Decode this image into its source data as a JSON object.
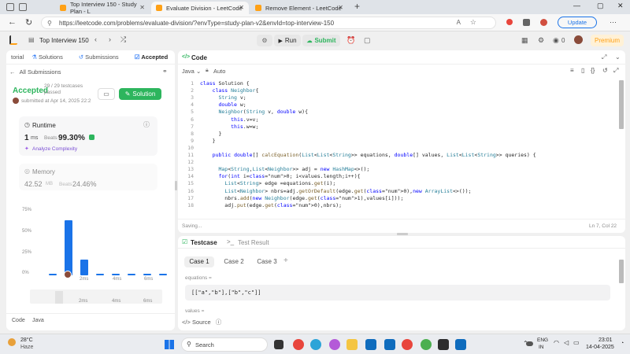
{
  "browser": {
    "tabs": [
      {
        "title": "Top Interview 150 - Study Plan - L",
        "fav": "#ffa116"
      },
      {
        "title": "Evaluate Division - LeetCode",
        "fav": "#ffa116"
      },
      {
        "title": "Remove Element - LeetCode",
        "fav": "#ffa116"
      }
    ],
    "url": "https://leetcode.com/problems/evaluate-division/?envType=study-plan-v2&envId=top-interview-150",
    "update_label": "Update"
  },
  "lc": {
    "study_plan": "Top Interview 150",
    "run": "Run",
    "submit": "Submit",
    "premium": "Premium",
    "streak": "0"
  },
  "left": {
    "tabs": [
      "torial",
      "Solutions",
      "Submissions",
      "Accepted"
    ],
    "all_submissions": "All Submissions",
    "status": "Accepted",
    "testcases": "29 / 29 testcases passed",
    "submitted": "submitted at Apr 14, 2025 22:2",
    "solution_btn": "Solution",
    "runtime_label": "Runtime",
    "runtime_value": "1",
    "runtime_unit": "ms",
    "beats_label": "Beats",
    "runtime_beats": "99.30%",
    "analyze": "Analyze Complexity",
    "memory_label": "Memory",
    "memory_value": "42.52",
    "memory_unit": "MB",
    "memory_beats": "24.46%",
    "y_ticks": [
      "75%",
      "50%",
      "25%",
      "0%"
    ],
    "x_ticks": [
      "2ms",
      "4ms",
      "6ms"
    ],
    "mini_ticks": [
      "2ms",
      "4ms",
      "6ms"
    ],
    "footer_code": "Code",
    "footer_lang": "Java"
  },
  "chart_data": {
    "type": "bar",
    "y_ticks": [
      "75%",
      "50%",
      "25%",
      "0%"
    ],
    "x_ticks": [
      "2ms",
      "4ms",
      "6ms"
    ],
    "values": [
      2,
      68,
      20,
      2,
      2,
      2,
      2,
      2
    ],
    "ylim": [
      0,
      80
    ]
  },
  "editor": {
    "title": "Code",
    "lang": "Java",
    "auto": "Auto",
    "lines": [
      "class Solution {",
      "    class Neighbor{",
      "      String v;",
      "      double w;",
      "      Neighbor(String v, double w){",
      "          this.v=v;",
      "          this.w=w;",
      "      }",
      "    }",
      "",
      "    public double[] calcEquation(List<List<String>> equations, double[] values, List<List<String>> queries) {",
      "",
      "      Map<String,List<Neighbor>> adj = new HashMap<>();",
      "      for(int i=0; i<values.length;i++){",
      "        List<String> edge =equations.get(i);",
      "        List<Neighbor> nbrs=adj.getOrDefault(edge.get(0),new ArrayList<>());",
      "        nbrs.add(new Neighbor(edge.get(1),values[i]));",
      "        adj.put(edge.get(0),nbrs);"
    ],
    "status_left": "Saving...",
    "status_right": "Ln 7, Col 22"
  },
  "testcase": {
    "title": "Testcase",
    "result": "Test Result",
    "cases": [
      "Case 1",
      "Case 2",
      "Case 3"
    ],
    "var1": "equations =",
    "val1": "[[\"a\",\"b\"],[\"b\",\"c\"]]",
    "var2": "values =",
    "source": "Source"
  },
  "taskbar": {
    "temp": "28°C",
    "weather": "Haze",
    "search": "Search",
    "lang1": "ENG",
    "lang2": "IN",
    "time": "23:01",
    "date": "14-04-2025"
  }
}
